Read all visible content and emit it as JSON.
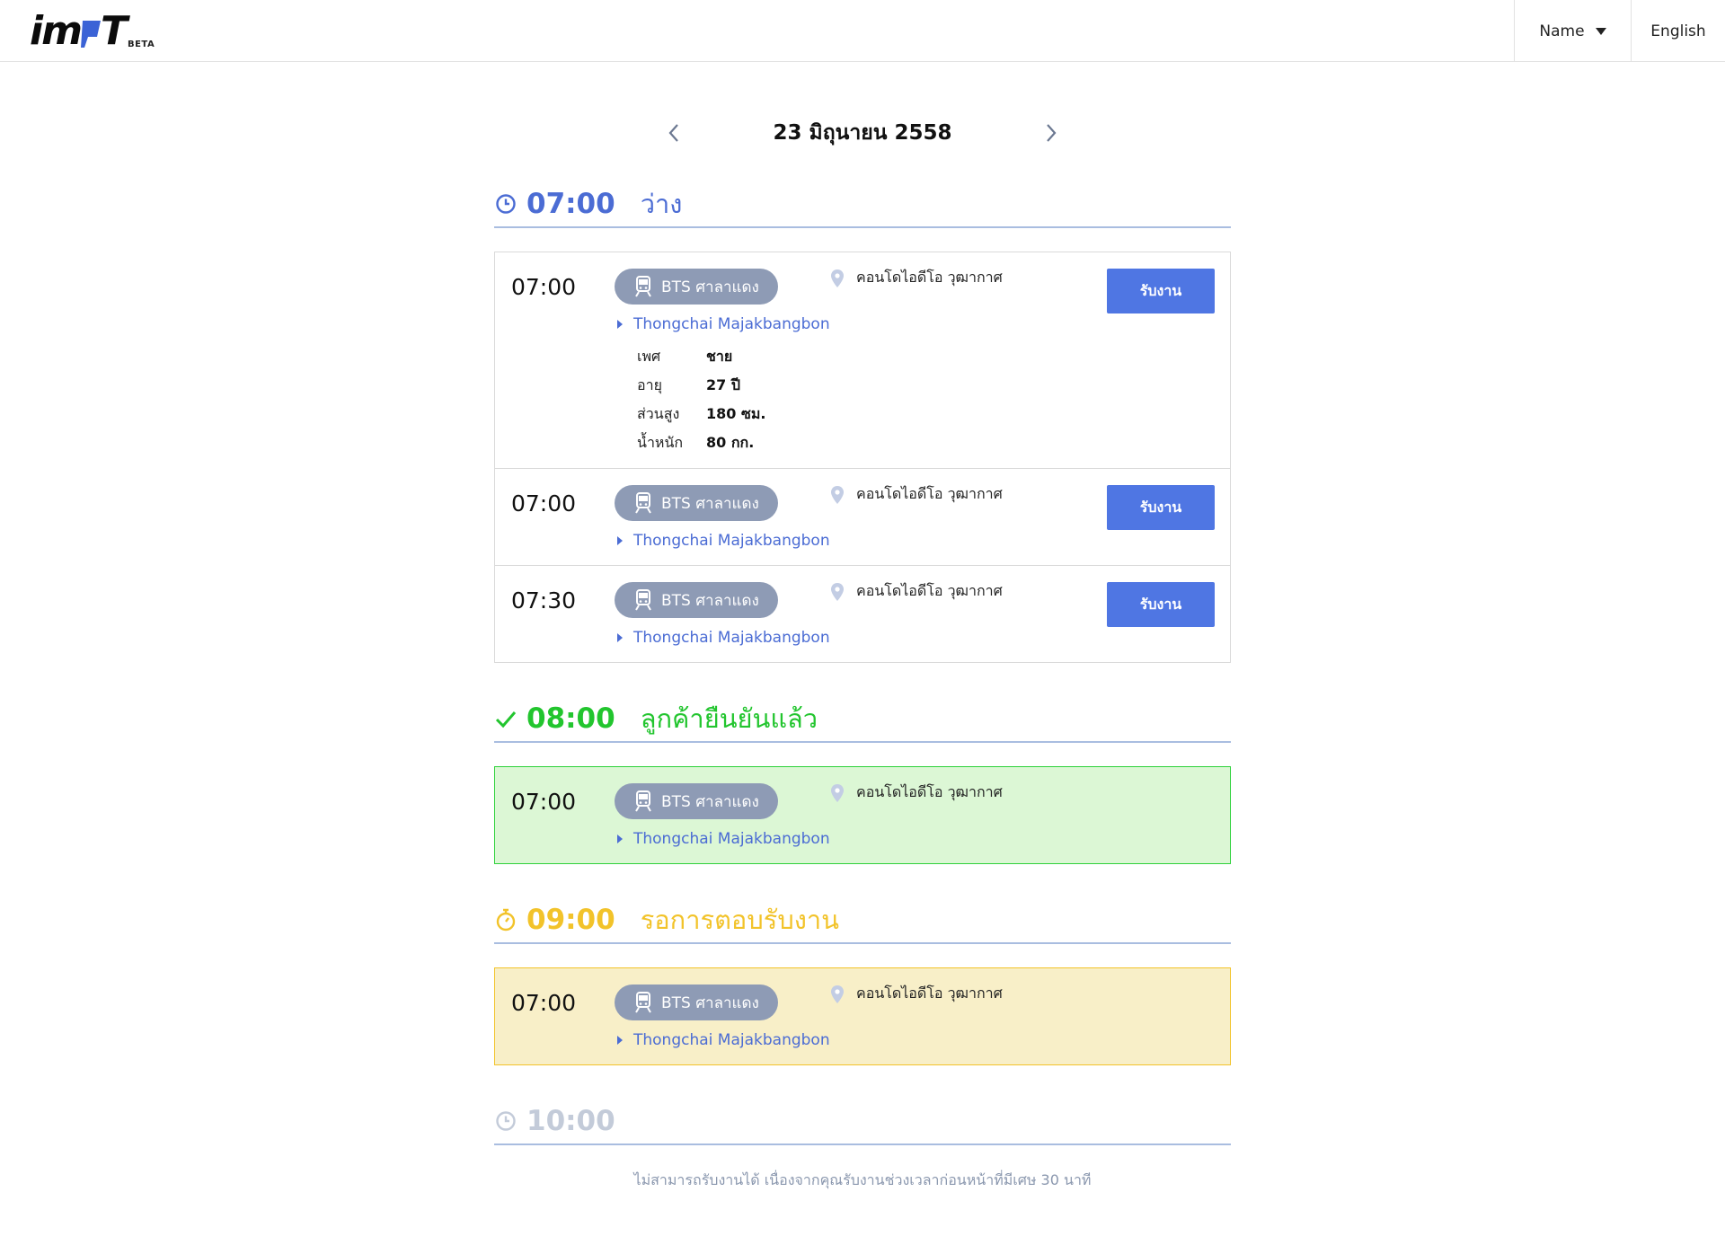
{
  "header": {
    "logo_text_left": "im",
    "logo_text_right": "T",
    "logo_badge": "BETA",
    "name_menu": "Name",
    "language": "English"
  },
  "date_nav": {
    "title": "23 มิถุนายน 2558"
  },
  "colors": {
    "available": "#4b6cd4",
    "confirmed": "#22c52e",
    "pending": "#f2c32a",
    "disabled": "#c3cbd9",
    "accept_button": "#4f76e3",
    "pill": "#8e9bb5"
  },
  "sections": [
    {
      "time": "07:00",
      "label": "ว่าง",
      "status": "available",
      "icon": "clock-icon",
      "cards": [
        {
          "time": "07:00",
          "station": "BTS ศาลาแดง",
          "trainer": "Thongchai Majakbangbon",
          "location": "คอนโดไอดีโอ วุฒากาศ",
          "action": "รับงาน",
          "details": [
            {
              "label": "เพศ",
              "value": "ชาย"
            },
            {
              "label": "อายุ",
              "value": "27 ปี"
            },
            {
              "label": "ส่วนสูง",
              "value": "180 ซม."
            },
            {
              "label": "น้ำหนัก",
              "value": "80 กก."
            }
          ]
        },
        {
          "time": "07:00",
          "station": "BTS ศาลาแดง",
          "trainer": "Thongchai Majakbangbon",
          "location": "คอนโดไอดีโอ วุฒากาศ",
          "action": "รับงาน"
        },
        {
          "time": "07:30",
          "station": "BTS ศาลาแดง",
          "trainer": "Thongchai Majakbangbon",
          "location": "คอนโดไอดีโอ วุฒากาศ",
          "action": "รับงาน"
        }
      ]
    },
    {
      "time": "08:00",
      "label": "ลูกค้ายืนยันแล้ว",
      "status": "confirmed",
      "icon": "check-icon",
      "cards": [
        {
          "time": "07:00",
          "station": "BTS ศาลาแดง",
          "trainer": "Thongchai Majakbangbon",
          "location": "คอนโดไอดีโอ วุฒากาศ"
        }
      ]
    },
    {
      "time": "09:00",
      "label": "รอการตอบรับงาน",
      "status": "pending",
      "icon": "stopwatch-icon",
      "cards": [
        {
          "time": "07:00",
          "station": "BTS ศาลาแดง",
          "trainer": "Thongchai Majakbangbon",
          "location": "คอนโดไอดีโอ วุฒากาศ"
        }
      ]
    },
    {
      "time": "10:00",
      "label": "",
      "status": "disabled",
      "icon": "clock-icon"
    }
  ],
  "footer_note": "ไม่สามารถรับงานได้ เนื่องจากคุณรับงานช่วงเวลาก่อนหน้าที่มีเศษ 30 นาที"
}
